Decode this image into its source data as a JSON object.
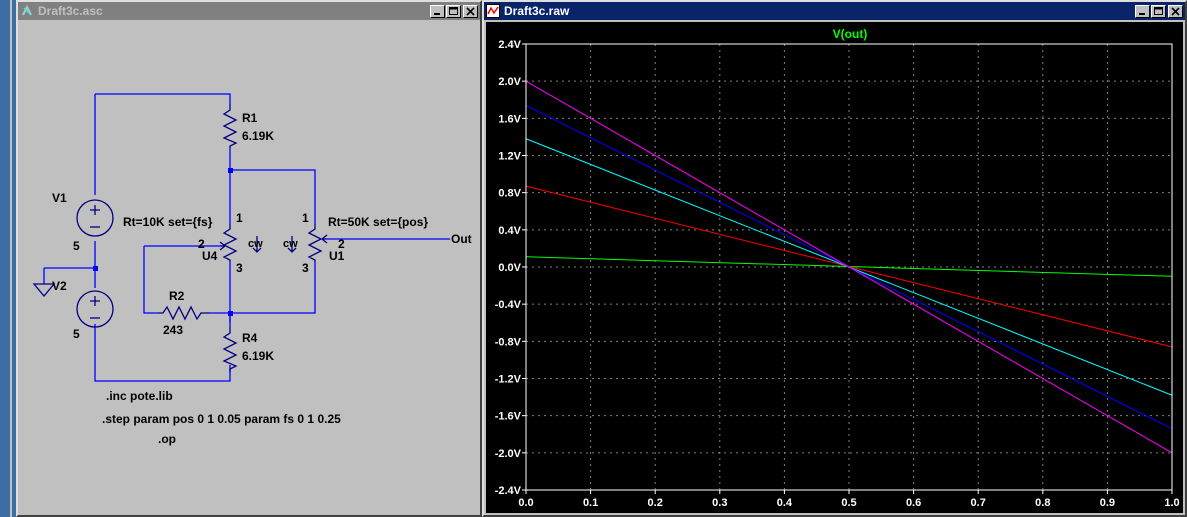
{
  "schematic_window": {
    "title": "Draft3c.asc",
    "components": {
      "r1": {
        "ref": "R1",
        "value": "6.19K"
      },
      "r2": {
        "ref": "R2",
        "value": "243"
      },
      "r4": {
        "ref": "R4",
        "value": "6.19K"
      },
      "v1": {
        "ref": "V1",
        "value": "5"
      },
      "v2": {
        "ref": "V2",
        "value": "5"
      },
      "u4": {
        "ref": "U4",
        "param": "Rt=10K set={fs}",
        "pin1": "1",
        "pin2": "2",
        "pin3": "3",
        "cw": "cw"
      },
      "u1": {
        "ref": "U1",
        "param": "Rt=50K set={pos}",
        "pin1": "1",
        "pin2": "2",
        "pin3": "3",
        "cw": "cw"
      }
    },
    "net_out": "Out",
    "directives": {
      "inc": ".inc pote.lib",
      "step": ".step param pos 0 1 0.05 param fs 0 1 0.25",
      "op": ".op"
    }
  },
  "plot_window": {
    "title": "Draft3c.raw"
  },
  "colors": {
    "wire": "#0000ff",
    "component": "#000080",
    "plot_bg": "#000000",
    "grid": "#808080",
    "axis_text": "#ffffff",
    "title_green": "#00ff00"
  },
  "chart_data": {
    "type": "line",
    "title": "V(out)",
    "xlabel": "",
    "ylabel": "",
    "xlim": [
      0.0,
      1.0
    ],
    "ylim": [
      -2.4,
      2.4
    ],
    "x_ticks": [
      "0.0",
      "0.1",
      "0.2",
      "0.3",
      "0.4",
      "0.5",
      "0.6",
      "0.7",
      "0.8",
      "0.9",
      "1.0"
    ],
    "y_ticks": [
      "2.4V",
      "2.0V",
      "1.6V",
      "1.2V",
      "0.8V",
      "0.4V",
      "0.0V",
      "-0.4V",
      "-0.8V",
      "-1.2V",
      "-1.6V",
      "-2.0V",
      "-2.4V"
    ],
    "grid": true,
    "series": [
      {
        "color": "#00ff00",
        "x": [
          0.0,
          1.0
        ],
        "y": [
          0.11,
          -0.1
        ]
      },
      {
        "color": "#ff0000",
        "x": [
          0.0,
          1.0
        ],
        "y": [
          0.87,
          -0.86
        ]
      },
      {
        "color": "#00ffff",
        "x": [
          0.0,
          1.0
        ],
        "y": [
          1.38,
          -1.38
        ]
      },
      {
        "color": "#0000ff",
        "x": [
          0.0,
          1.0
        ],
        "y": [
          1.74,
          -1.74
        ]
      },
      {
        "color": "#ff00ff",
        "x": [
          0.0,
          1.0
        ],
        "y": [
          2.0,
          -2.0
        ]
      }
    ]
  }
}
